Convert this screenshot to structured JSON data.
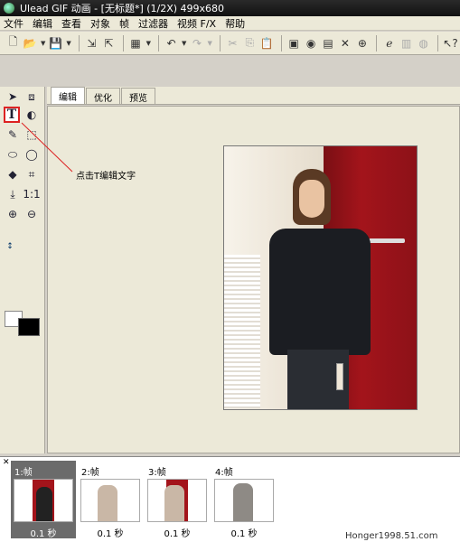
{
  "window": {
    "title": "Ulead GIF 动画 - [无标题*] (1/2X)  499x680"
  },
  "menu": {
    "items": [
      "文件",
      "编辑",
      "查看",
      "对象",
      "帧",
      "过滤器",
      "视频 F/X",
      "帮助"
    ]
  },
  "toolbar": {
    "icons": [
      "new-file-icon",
      "open-folder-icon",
      "save-icon",
      "import-icon",
      "export-icon",
      "add-frame-icon",
      "undo-icon",
      "redo-icon",
      "cut-icon",
      "copy-icon",
      "paste-icon",
      "optimize-icon",
      "preview-icon",
      "browser-icon",
      "delete-icon",
      "web-icon",
      "ie-icon",
      "help-icon"
    ]
  },
  "tabs": [
    "编辑",
    "优化",
    "预览"
  ],
  "annotation": {
    "text": "点击T编辑文字"
  },
  "frames": [
    {
      "label": "1:帧",
      "time": "0.1 秒",
      "active": true
    },
    {
      "label": "2:帧",
      "time": "0.1 秒",
      "active": false
    },
    {
      "label": "3:帧",
      "time": "0.1 秒",
      "active": false
    },
    {
      "label": "4:帧",
      "time": "0.1 秒",
      "active": false
    }
  ],
  "watermark": "Honger1998.51.com",
  "colors": {
    "titlebar": "#111111",
    "selection_highlight": "#dd2222",
    "door_red": "#a3141b",
    "active_frame": "#6b6b6b"
  }
}
